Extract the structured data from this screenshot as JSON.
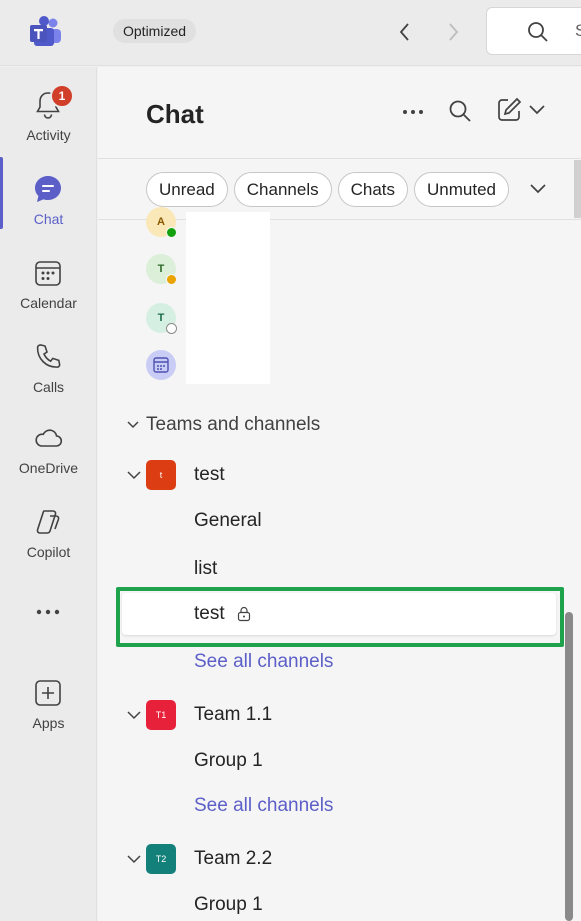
{
  "topbar": {
    "badge": "Optimized",
    "search_placeholder": "S"
  },
  "rail": {
    "items": [
      {
        "label": "Activity",
        "badge": "1"
      },
      {
        "label": "Chat"
      },
      {
        "label": "Calendar"
      },
      {
        "label": "Calls"
      },
      {
        "label": "OneDrive"
      },
      {
        "label": "Copilot"
      },
      {
        "label": "Apps"
      }
    ]
  },
  "panel": {
    "title": "Chat",
    "filters": [
      "Unread",
      "Channels",
      "Chats",
      "Unmuted"
    ]
  },
  "chats": [
    {
      "initial": "A",
      "status": "available"
    },
    {
      "initial": "T",
      "status": "away"
    },
    {
      "initial": "T",
      "status": "offline"
    },
    {
      "initial": "",
      "status": "none"
    }
  ],
  "teams_section": {
    "header": "Teams and channels",
    "teams": [
      {
        "tile": "t",
        "name": "test",
        "color": "#dc3d13",
        "channels": [
          "General",
          "list",
          "test"
        ],
        "see_all": "See all channels"
      },
      {
        "tile": "T1",
        "name": "Team 1.1",
        "color": "#e8213b",
        "channels": [
          "Group 1"
        ],
        "see_all": "See all channels"
      },
      {
        "tile": "T2",
        "name": "Team 2.2",
        "color": "#13807a",
        "channels": [
          "Group 1"
        ]
      }
    ]
  },
  "colors": {
    "accent": "#5b5fc7",
    "highlight": "#1fa24c",
    "badge": "#d13f2a"
  }
}
